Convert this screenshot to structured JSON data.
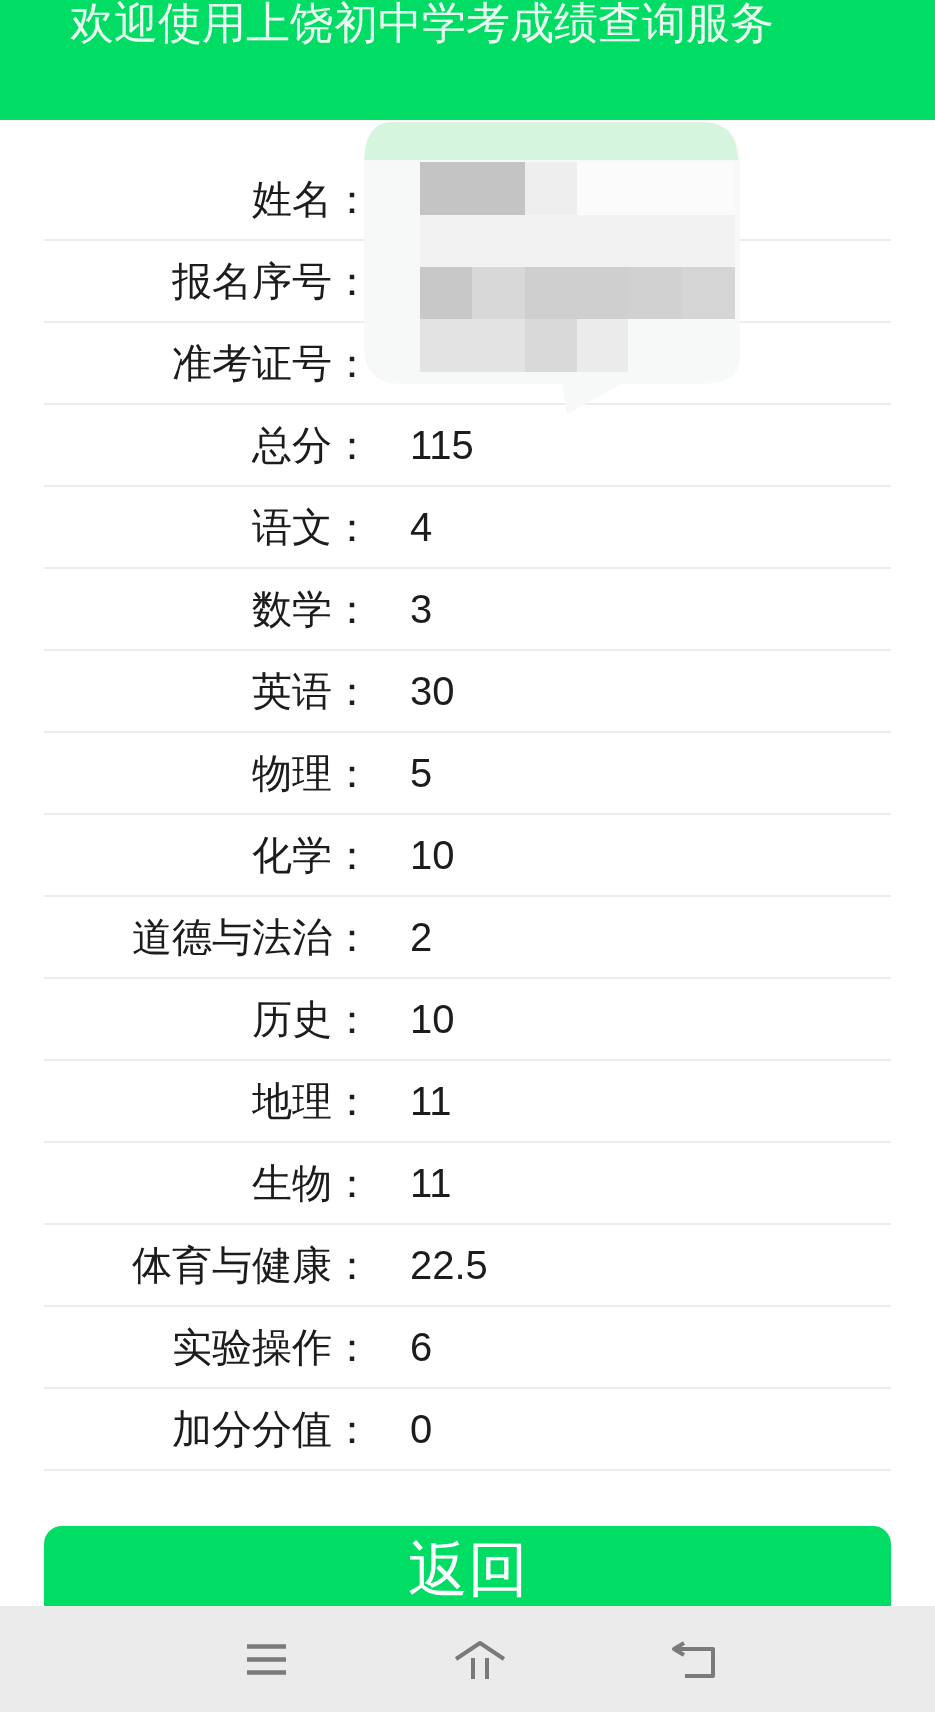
{
  "header": {
    "title": "欢迎使用上饶初中学考成绩查询服务"
  },
  "rows": [
    {
      "label": "姓名："
    },
    {
      "label": "报名序号："
    },
    {
      "label": "准考证号："
    },
    {
      "label": "总分：",
      "value": "115"
    },
    {
      "label": "语文：",
      "value": "4"
    },
    {
      "label": "数学：",
      "value": "3"
    },
    {
      "label": "英语：",
      "value": "30"
    },
    {
      "label": "物理：",
      "value": "5"
    },
    {
      "label": "化学：",
      "value": "10"
    },
    {
      "label": "道德与法治：",
      "value": "2"
    },
    {
      "label": "历史：",
      "value": "10"
    },
    {
      "label": "地理：",
      "value": "11"
    },
    {
      "label": "生物：",
      "value": "11"
    },
    {
      "label": "体育与健康：",
      "value": "22.5"
    },
    {
      "label": "实验操作：",
      "value": "6"
    },
    {
      "label": "加分分值：",
      "value": "0"
    }
  ],
  "return_button": {
    "label": "返回"
  }
}
